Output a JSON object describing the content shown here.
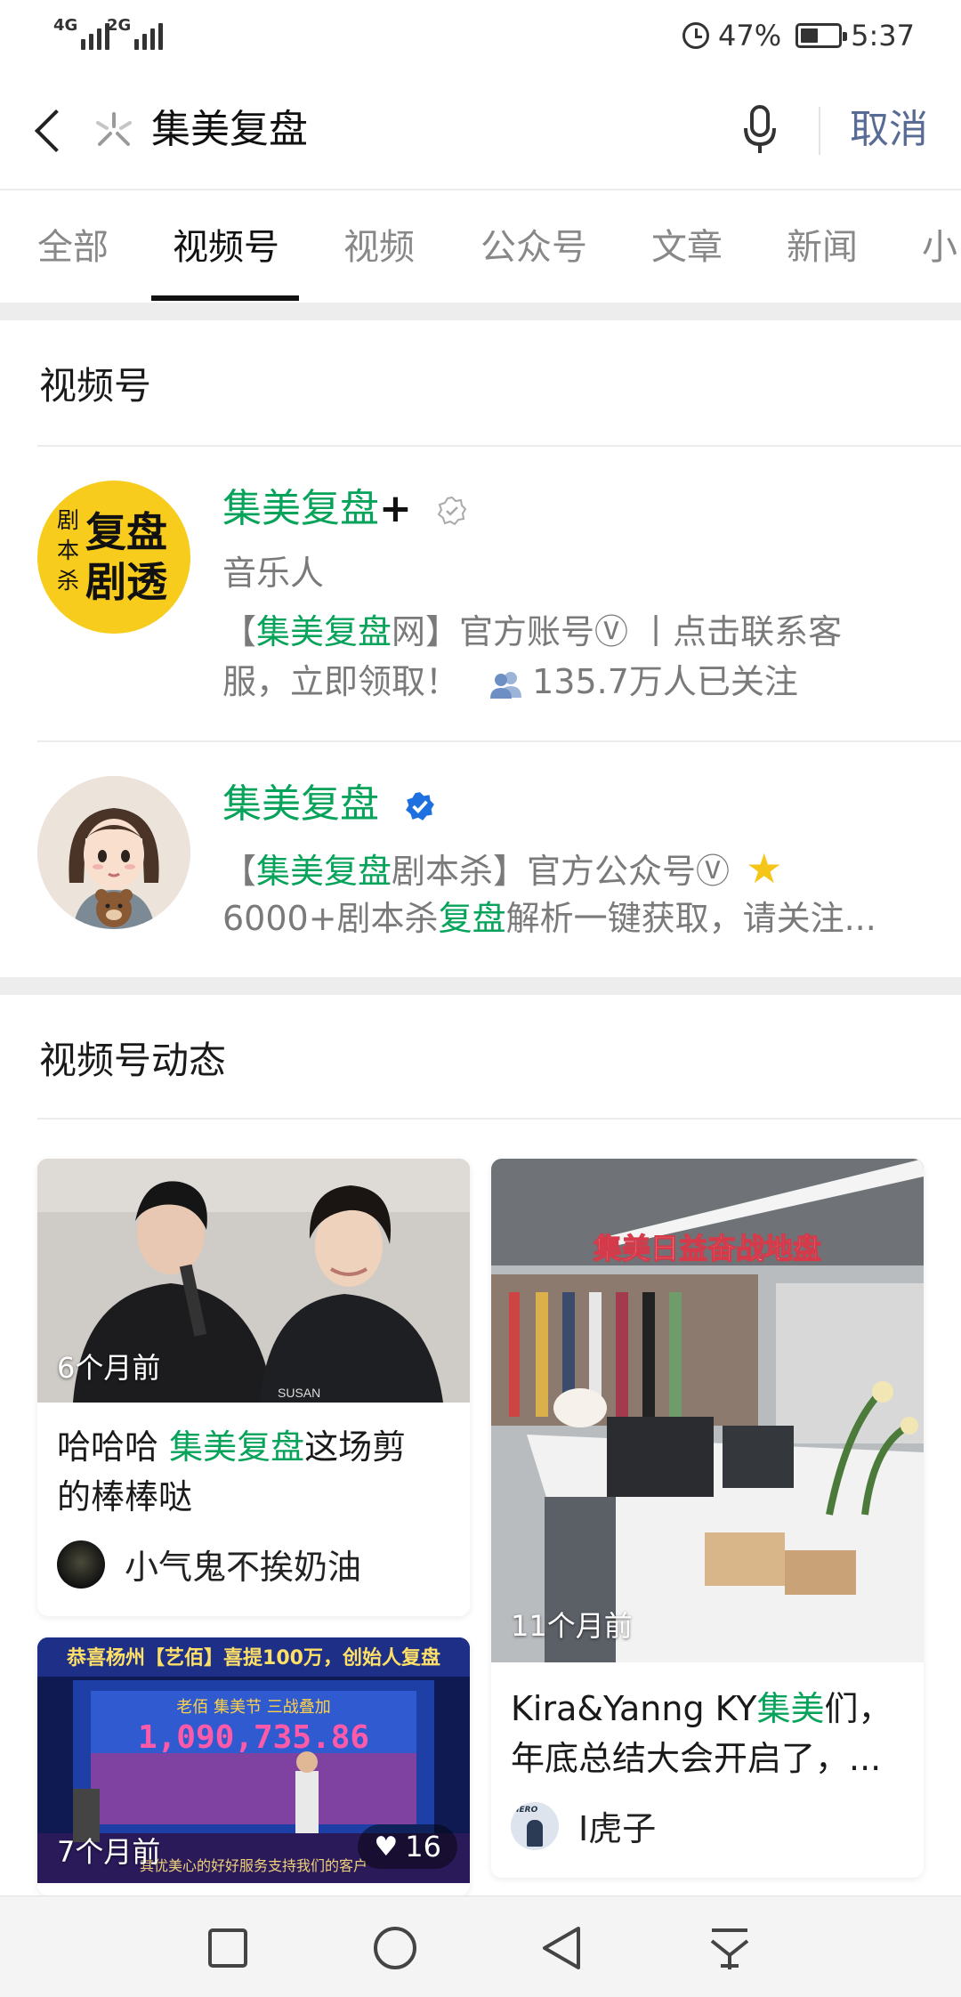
{
  "status_bar": {
    "sim1": "4G",
    "sim2": "2G",
    "battery": "47%",
    "battery_level": 0.47,
    "time": "5:37"
  },
  "search": {
    "query": "集美复盘",
    "cancel_label": "取消"
  },
  "tabs": [
    {
      "label": "全部"
    },
    {
      "label": "视频号"
    },
    {
      "label": "视频"
    },
    {
      "label": "公众号"
    },
    {
      "label": "文章"
    },
    {
      "label": "新闻"
    },
    {
      "label": "小"
    }
  ],
  "active_tab": "视频号",
  "channels_section": {
    "title": "视频号",
    "accounts": [
      {
        "name": "集美复盘",
        "plus": "+",
        "category": "音乐人",
        "avatar_text": [
          "剧",
          "本",
          "杀",
          "复盘",
          "剧透"
        ],
        "desc1_prefix": "【",
        "desc1_hl": "集美复盘",
        "desc1_rest": "网】官方账号Ⓥ 丨点击联系客",
        "desc2": "服，立即领取！",
        "followers": "135.7万人已关注"
      },
      {
        "name": "集美复盘",
        "desc1_prefix": "【",
        "desc1_hl": "集美复盘",
        "desc1_rest": "剧本杀】官方公众号Ⓥ",
        "desc2_prefix": "6000+剧本杀",
        "desc2_hl": "复盘",
        "desc2_rest": "解析一键获取，请关注..."
      }
    ]
  },
  "feed_section": {
    "title": "视频号动态",
    "posts": [
      {
        "time": "6个月前",
        "text_prefix": "哈哈哈 ",
        "text_hl": "集美复盘",
        "text_rest": "这场剪",
        "text_line2": "的棒棒哒",
        "author": "小气鬼不挨奶油",
        "thumb_caption": "SUSAN"
      },
      {
        "time": "11个月前",
        "banner": "集美日益奋战地盘",
        "text_prefix": "Kira&Yanng KY",
        "text_hl": "集美",
        "text_rest": "们，",
        "text_line2": "年底总结大会开启了，...",
        "author": "I虎子",
        "author_avatar_text": "HERO"
      },
      {
        "time": "7个月前",
        "likes": "16",
        "banner": "恭喜杨州【艺佰】喜提100万，创始人复盘",
        "screen_text": "老佰 集美节 三战叠加",
        "screen_amount": "1,090,735.86",
        "subtitle": "其优美心的好好服务支持我们的客户"
      }
    ]
  },
  "colors": {
    "highlight": "#07a35a",
    "link": "#576b95",
    "verified": "#1e6fe0"
  }
}
